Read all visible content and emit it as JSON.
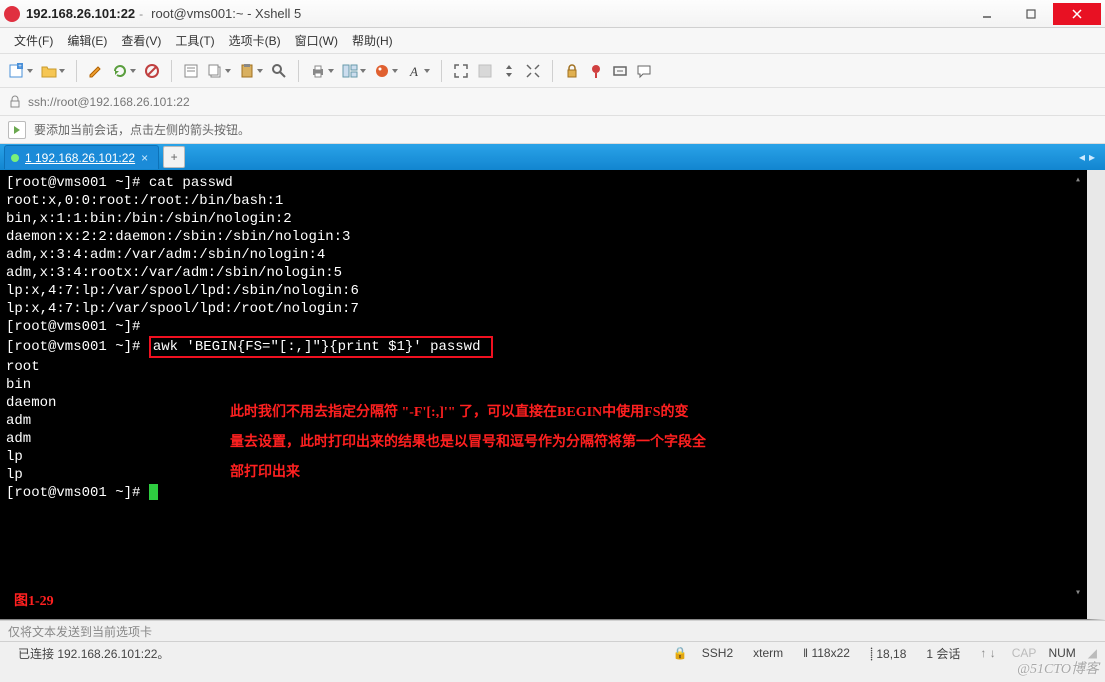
{
  "titlebar": {
    "host": "192.168.26.101:22",
    "tail": "root@vms001:~ - Xshell 5"
  },
  "menubar": [
    "文件(F)",
    "编辑(E)",
    "查看(V)",
    "工具(T)",
    "选项卡(B)",
    "窗口(W)",
    "帮助(H)"
  ],
  "address": {
    "url": "ssh://root@192.168.26.101:22"
  },
  "hint": "要添加当前会话，点击左侧的箭头按钮。",
  "tab": {
    "label": "1 192.168.26.101:22"
  },
  "terminal": {
    "lines": [
      "[root@vms001 ~]# cat passwd",
      "root:x,0:0:root:/root:/bin/bash:1",
      "bin,x:1:1:bin:/bin:/sbin/nologin:2",
      "daemon:x:2:2:daemon:/sbin:/sbin/nologin:3",
      "adm,x:3:4:adm:/var/adm:/sbin/nologin:4",
      "adm,x:3:4:rootx:/var/adm:/sbin/nologin:5",
      "lp:x,4:7:lp:/var/spool/lpd:/sbin/nologin:6",
      "lp:x,4:7:lp:/var/spool/lpd:/root/nologin:7",
      "[root@vms001 ~]# ",
      "",
      "root",
      "bin",
      "daemon",
      "adm",
      "adm",
      "lp",
      "lp",
      "[root@vms001 ~]# "
    ],
    "hl_prefix": "[root@vms001 ~]# ",
    "hl_cmd": "awk 'BEGIN{FS=\"[:,]\"}{print $1}' passwd ",
    "annotation_l1": "此时我们不用去指定分隔符 \"-F'[:,]'\" 了，可以直接在BEGIN中使用FS的变",
    "annotation_l2": "量去设置，此时打印出来的结果也是以冒号和逗号作为分隔符将第一个字段全",
    "annotation_l3": "部打印出来",
    "fig": "图1-29"
  },
  "sendbar": "仅将文本发送到当前选项卡",
  "status": {
    "conn": "已连接 192.168.26.101:22。",
    "ssh": "SSH2",
    "term": "xterm",
    "size": "118x22",
    "pos": "18,18",
    "sess": "1 会话"
  },
  "toolbar_icons": [
    "new-session-icon",
    "open-icon",
    "edit-icon",
    "reconnect-icon",
    "disconnect-icon",
    "copy-icon",
    "paste-icon",
    "find-icon",
    "print-icon",
    "layout-icon",
    "color-icon",
    "font-icon",
    "fullscreen-icon",
    "transparency-icon",
    "lock-icon",
    "position-icon",
    "fit-icon",
    "help-icon"
  ],
  "watermark": "@51CTO博客",
  "colors": {
    "tab_bg": "#1b8bd8",
    "accent_red": "#ff2020",
    "cursor": "#2ecc40",
    "close_btn": "#e81123"
  }
}
